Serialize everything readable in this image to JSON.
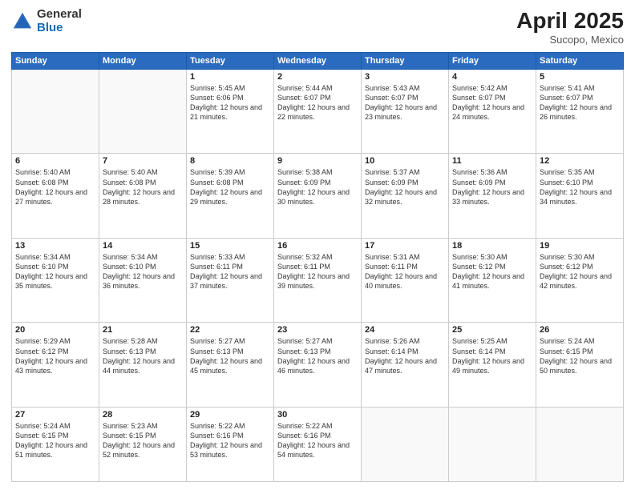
{
  "logo": {
    "general": "General",
    "blue": "Blue"
  },
  "title": {
    "month": "April 2025",
    "location": "Sucopo, Mexico"
  },
  "headers": [
    "Sunday",
    "Monday",
    "Tuesday",
    "Wednesday",
    "Thursday",
    "Friday",
    "Saturday"
  ],
  "weeks": [
    [
      {
        "day": "",
        "sunrise": "",
        "sunset": "",
        "daylight": ""
      },
      {
        "day": "",
        "sunrise": "",
        "sunset": "",
        "daylight": ""
      },
      {
        "day": "1",
        "sunrise": "Sunrise: 5:45 AM",
        "sunset": "Sunset: 6:06 PM",
        "daylight": "Daylight: 12 hours and 21 minutes."
      },
      {
        "day": "2",
        "sunrise": "Sunrise: 5:44 AM",
        "sunset": "Sunset: 6:07 PM",
        "daylight": "Daylight: 12 hours and 22 minutes."
      },
      {
        "day": "3",
        "sunrise": "Sunrise: 5:43 AM",
        "sunset": "Sunset: 6:07 PM",
        "daylight": "Daylight: 12 hours and 23 minutes."
      },
      {
        "day": "4",
        "sunrise": "Sunrise: 5:42 AM",
        "sunset": "Sunset: 6:07 PM",
        "daylight": "Daylight: 12 hours and 24 minutes."
      },
      {
        "day": "5",
        "sunrise": "Sunrise: 5:41 AM",
        "sunset": "Sunset: 6:07 PM",
        "daylight": "Daylight: 12 hours and 26 minutes."
      }
    ],
    [
      {
        "day": "6",
        "sunrise": "Sunrise: 5:40 AM",
        "sunset": "Sunset: 6:08 PM",
        "daylight": "Daylight: 12 hours and 27 minutes."
      },
      {
        "day": "7",
        "sunrise": "Sunrise: 5:40 AM",
        "sunset": "Sunset: 6:08 PM",
        "daylight": "Daylight: 12 hours and 28 minutes."
      },
      {
        "day": "8",
        "sunrise": "Sunrise: 5:39 AM",
        "sunset": "Sunset: 6:08 PM",
        "daylight": "Daylight: 12 hours and 29 minutes."
      },
      {
        "day": "9",
        "sunrise": "Sunrise: 5:38 AM",
        "sunset": "Sunset: 6:09 PM",
        "daylight": "Daylight: 12 hours and 30 minutes."
      },
      {
        "day": "10",
        "sunrise": "Sunrise: 5:37 AM",
        "sunset": "Sunset: 6:09 PM",
        "daylight": "Daylight: 12 hours and 32 minutes."
      },
      {
        "day": "11",
        "sunrise": "Sunrise: 5:36 AM",
        "sunset": "Sunset: 6:09 PM",
        "daylight": "Daylight: 12 hours and 33 minutes."
      },
      {
        "day": "12",
        "sunrise": "Sunrise: 5:35 AM",
        "sunset": "Sunset: 6:10 PM",
        "daylight": "Daylight: 12 hours and 34 minutes."
      }
    ],
    [
      {
        "day": "13",
        "sunrise": "Sunrise: 5:34 AM",
        "sunset": "Sunset: 6:10 PM",
        "daylight": "Daylight: 12 hours and 35 minutes."
      },
      {
        "day": "14",
        "sunrise": "Sunrise: 5:34 AM",
        "sunset": "Sunset: 6:10 PM",
        "daylight": "Daylight: 12 hours and 36 minutes."
      },
      {
        "day": "15",
        "sunrise": "Sunrise: 5:33 AM",
        "sunset": "Sunset: 6:11 PM",
        "daylight": "Daylight: 12 hours and 37 minutes."
      },
      {
        "day": "16",
        "sunrise": "Sunrise: 5:32 AM",
        "sunset": "Sunset: 6:11 PM",
        "daylight": "Daylight: 12 hours and 39 minutes."
      },
      {
        "day": "17",
        "sunrise": "Sunrise: 5:31 AM",
        "sunset": "Sunset: 6:11 PM",
        "daylight": "Daylight: 12 hours and 40 minutes."
      },
      {
        "day": "18",
        "sunrise": "Sunrise: 5:30 AM",
        "sunset": "Sunset: 6:12 PM",
        "daylight": "Daylight: 12 hours and 41 minutes."
      },
      {
        "day": "19",
        "sunrise": "Sunrise: 5:30 AM",
        "sunset": "Sunset: 6:12 PM",
        "daylight": "Daylight: 12 hours and 42 minutes."
      }
    ],
    [
      {
        "day": "20",
        "sunrise": "Sunrise: 5:29 AM",
        "sunset": "Sunset: 6:12 PM",
        "daylight": "Daylight: 12 hours and 43 minutes."
      },
      {
        "day": "21",
        "sunrise": "Sunrise: 5:28 AM",
        "sunset": "Sunset: 6:13 PM",
        "daylight": "Daylight: 12 hours and 44 minutes."
      },
      {
        "day": "22",
        "sunrise": "Sunrise: 5:27 AM",
        "sunset": "Sunset: 6:13 PM",
        "daylight": "Daylight: 12 hours and 45 minutes."
      },
      {
        "day": "23",
        "sunrise": "Sunrise: 5:27 AM",
        "sunset": "Sunset: 6:13 PM",
        "daylight": "Daylight: 12 hours and 46 minutes."
      },
      {
        "day": "24",
        "sunrise": "Sunrise: 5:26 AM",
        "sunset": "Sunset: 6:14 PM",
        "daylight": "Daylight: 12 hours and 47 minutes."
      },
      {
        "day": "25",
        "sunrise": "Sunrise: 5:25 AM",
        "sunset": "Sunset: 6:14 PM",
        "daylight": "Daylight: 12 hours and 49 minutes."
      },
      {
        "day": "26",
        "sunrise": "Sunrise: 5:24 AM",
        "sunset": "Sunset: 6:15 PM",
        "daylight": "Daylight: 12 hours and 50 minutes."
      }
    ],
    [
      {
        "day": "27",
        "sunrise": "Sunrise: 5:24 AM",
        "sunset": "Sunset: 6:15 PM",
        "daylight": "Daylight: 12 hours and 51 minutes."
      },
      {
        "day": "28",
        "sunrise": "Sunrise: 5:23 AM",
        "sunset": "Sunset: 6:15 PM",
        "daylight": "Daylight: 12 hours and 52 minutes."
      },
      {
        "day": "29",
        "sunrise": "Sunrise: 5:22 AM",
        "sunset": "Sunset: 6:16 PM",
        "daylight": "Daylight: 12 hours and 53 minutes."
      },
      {
        "day": "30",
        "sunrise": "Sunrise: 5:22 AM",
        "sunset": "Sunset: 6:16 PM",
        "daylight": "Daylight: 12 hours and 54 minutes."
      },
      {
        "day": "",
        "sunrise": "",
        "sunset": "",
        "daylight": ""
      },
      {
        "day": "",
        "sunrise": "",
        "sunset": "",
        "daylight": ""
      },
      {
        "day": "",
        "sunrise": "",
        "sunset": "",
        "daylight": ""
      }
    ]
  ]
}
